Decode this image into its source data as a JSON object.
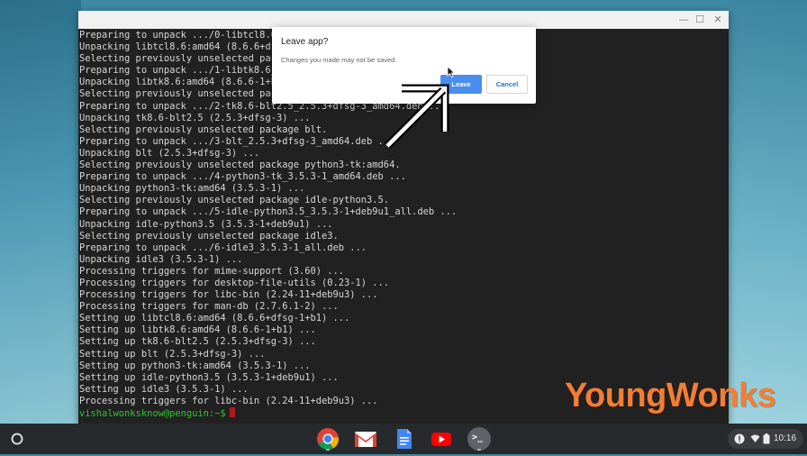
{
  "terminal": {
    "lines": [
      "Preparing to unpack .../0-libtcl8.6_",
      "Unpacking libtcl8.6:amd64 (8.6.6+dfs",
      "Selecting previously unselected pack",
      "Preparing to unpack .../1-libtk8.6_8",
      "Unpacking libtk8.6:amd64 (8.6.6-1+b1",
      "Selecting previously unselected pack",
      "Preparing to unpack .../2-tk8.6-blt2.5_2.5.3+dfsg-3_amd64.deb ...",
      "Unpacking tk8.6-blt2.5 (2.5.3+dfsg-3) ...",
      "Selecting previously unselected package blt.",
      "Preparing to unpack .../3-blt_2.5.3+dfsg-3_amd64.deb ...",
      "Unpacking blt (2.5.3+dfsg-3) ...",
      "Selecting previously unselected package python3-tk:amd64.",
      "Preparing to unpack .../4-python3-tk_3.5.3-1_amd64.deb ...",
      "Unpacking python3-tk:amd64 (3.5.3-1) ...",
      "Selecting previously unselected package idle-python3.5.",
      "Preparing to unpack .../5-idle-python3.5_3.5.3-1+deb9u1_all.deb ...",
      "Unpacking idle-python3.5 (3.5.3-1+deb9u1) ...",
      "Selecting previously unselected package idle3.",
      "Preparing to unpack .../6-idle3_3.5.3-1_all.deb ...",
      "Unpacking idle3 (3.5.3-1) ...",
      "Processing triggers for mime-support (3.60) ...",
      "Processing triggers for desktop-file-utils (0.23-1) ...",
      "Processing triggers for libc-bin (2.24-11+deb9u3) ...",
      "Processing triggers for man-db (2.7.6.1-2) ...",
      "Setting up libtcl8.6:amd64 (8.6.6+dfsg-1+b1) ...",
      "Setting up libtk8.6:amd64 (8.6.6-1+b1) ...",
      "Setting up tk8.6-blt2.5 (2.5.3+dfsg-3) ...",
      "Setting up blt (2.5.3+dfsg-3) ...",
      "Setting up python3-tk:amd64 (3.5.3-1) ...",
      "Setting up idle-python3.5 (3.5.3-1+deb9u1) ...",
      "Setting up idle3 (3.5.3-1) ...",
      "Processing triggers for libc-bin (2.24-11+deb9u3) ..."
    ],
    "prompt": "vishalwonksknow@penguin:~$"
  },
  "window_controls": {
    "minimize": "—",
    "maximize": "☐",
    "close": "✕"
  },
  "dialog": {
    "title": "Leave app?",
    "message": "Changes you made may not be saved.",
    "leave_label": "Leave",
    "cancel_label": "Cancel"
  },
  "watermark": {
    "text": "YoungWonks"
  },
  "shelf": {
    "apps": [
      "chrome-icon",
      "gmail-icon",
      "docs-icon",
      "youtube-icon",
      "terminal-icon"
    ],
    "terminal_glyph": ">_",
    "clock": "10:16"
  },
  "colors": {
    "accent": "#4a8df0",
    "prompt": "#2fc52f",
    "watermark": "#f37d33"
  }
}
